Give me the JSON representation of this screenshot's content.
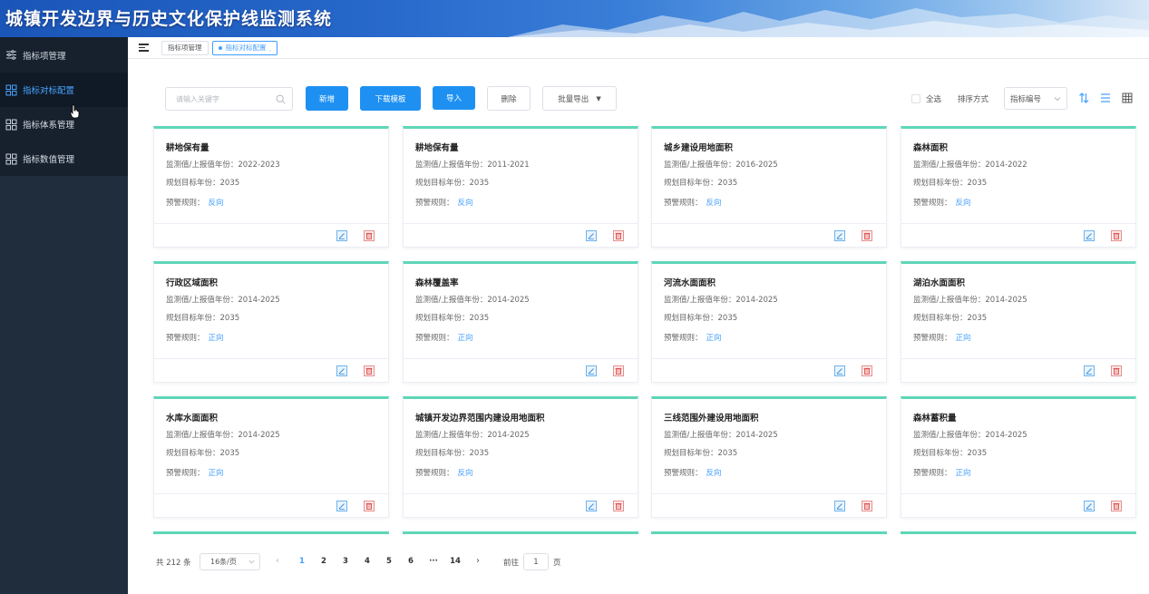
{
  "header": {
    "title": "城镇开发边界与历史文化保护线监测系统"
  },
  "sidebar": {
    "items": [
      {
        "label": "指标项管理",
        "icon": "sliders-icon"
      },
      {
        "label": "指标对标配置",
        "icon": "grid-icon",
        "active": true
      },
      {
        "label": "指标体系管理",
        "icon": "grid-icon"
      },
      {
        "label": "指标数值管理",
        "icon": "grid-icon"
      }
    ]
  },
  "tabs": [
    {
      "label": "指标项管理"
    },
    {
      "label": "指标对标配置"
    }
  ],
  "toolbar": {
    "search_placeholder": "请输入关键字",
    "add_label": "新增",
    "download_template_label": "下载模板",
    "import_label": "导入",
    "delete_label": "删除",
    "batch_export_label": "批量导出",
    "select_all_label": "全选",
    "sort_label": "排序方式",
    "sort_value": "指标编号"
  },
  "card_labels": {
    "monitor_years": "监测值/上报值年份：",
    "target_year": "规划目标年份：",
    "warning_rule": "预警规则："
  },
  "cards": [
    {
      "title": "耕地保有量",
      "monitor_years": "2022-2023",
      "target_year": "2035",
      "rule": "反向"
    },
    {
      "title": "耕地保有量",
      "monitor_years": "2011-2021",
      "target_year": "2035",
      "rule": "反向"
    },
    {
      "title": "城乡建设用地面积",
      "monitor_years": "2016-2025",
      "target_year": "2035",
      "rule": "反向"
    },
    {
      "title": "森林面积",
      "monitor_years": "2014-2022",
      "target_year": "2035",
      "rule": "反向"
    },
    {
      "title": "行政区域面积",
      "monitor_years": "2014-2025",
      "target_year": "2035",
      "rule": "正向"
    },
    {
      "title": "森林覆盖率",
      "monitor_years": "2014-2025",
      "target_year": "2035",
      "rule": "正向"
    },
    {
      "title": "河流水面面积",
      "monitor_years": "2014-2025",
      "target_year": "2035",
      "rule": "正向"
    },
    {
      "title": "湖泊水面面积",
      "monitor_years": "2014-2025",
      "target_year": "2035",
      "rule": "正向"
    },
    {
      "title": "水库水面面积",
      "monitor_years": "2014-2025",
      "target_year": "2035",
      "rule": "正向"
    },
    {
      "title": "城镇开发边界范围内建设用地面积",
      "monitor_years": "2014-2025",
      "target_year": "2035",
      "rule": "反向"
    },
    {
      "title": "三线范围外建设用地面积",
      "monitor_years": "2014-2025",
      "target_year": "2035",
      "rule": "反向"
    },
    {
      "title": "森林蓄积量",
      "monitor_years": "2014-2025",
      "target_year": "2035",
      "rule": "正向"
    }
  ],
  "pagination": {
    "total": "共 212 条",
    "page_size": "16条/页",
    "pages": [
      "1",
      "2",
      "3",
      "4",
      "5",
      "6",
      "···",
      "14"
    ],
    "current": "1",
    "goto_label": "前往",
    "goto_value": "1",
    "page_unit": "页"
  },
  "colors": {
    "accent": "#1e90f2",
    "card_top": "#5fd6b8",
    "sidebar_bg": "#1f2d3d",
    "link": "#409eff"
  }
}
